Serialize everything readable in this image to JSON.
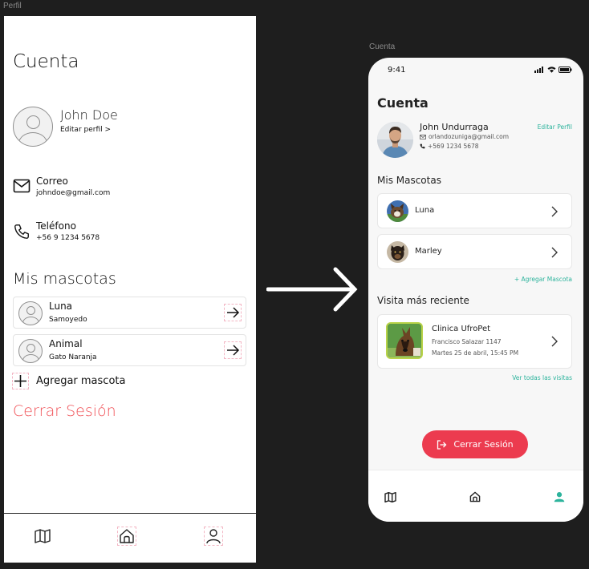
{
  "frames": {
    "left_label": "Perfil",
    "right_label": "Cuenta"
  },
  "wireframe": {
    "title": "Cuenta",
    "user": {
      "name": "John Doe",
      "edit_label": "Editar perfil >"
    },
    "email": {
      "label": "Correo",
      "value": "johndoe@gmail.com"
    },
    "phone": {
      "label": "Teléfono",
      "value": "+56 9 1234 5678"
    },
    "pets_title": "Mis mascotas",
    "pets": [
      {
        "name": "Luna",
        "breed": "Samoyedo"
      },
      {
        "name": "Animal",
        "breed": "Gato Naranja"
      }
    ],
    "add_pet": "Agregar mascota",
    "logout": "Cerrar Sesión",
    "nav": [
      "map-icon",
      "home-icon",
      "user-icon"
    ]
  },
  "phone": {
    "status_time": "9:41",
    "title": "Cuenta",
    "user": {
      "name": "John Undurraga",
      "email": "orlandozuniga@gmail.com",
      "phone": "+569 1234 5678",
      "edit_label": "Editar Perfil"
    },
    "pets_title": "Mis Mascotas",
    "pets": [
      {
        "name": "Luna"
      },
      {
        "name": "Marley"
      }
    ],
    "add_pet": "+ Agregar Mascota",
    "visit_title": "Visita más reciente",
    "visit": {
      "clinic": "Clinica UfroPet",
      "address": "Francisco Salazar 1147",
      "date": "Martes 25 de abril, 15:45 PM"
    },
    "all_visits": "Ver todas las visitas",
    "logout": "Cerrar Sesión",
    "nav": [
      "map-icon",
      "home-icon",
      "user-icon"
    ],
    "accent": "#2cb39c",
    "danger": "#ec3b4f"
  }
}
